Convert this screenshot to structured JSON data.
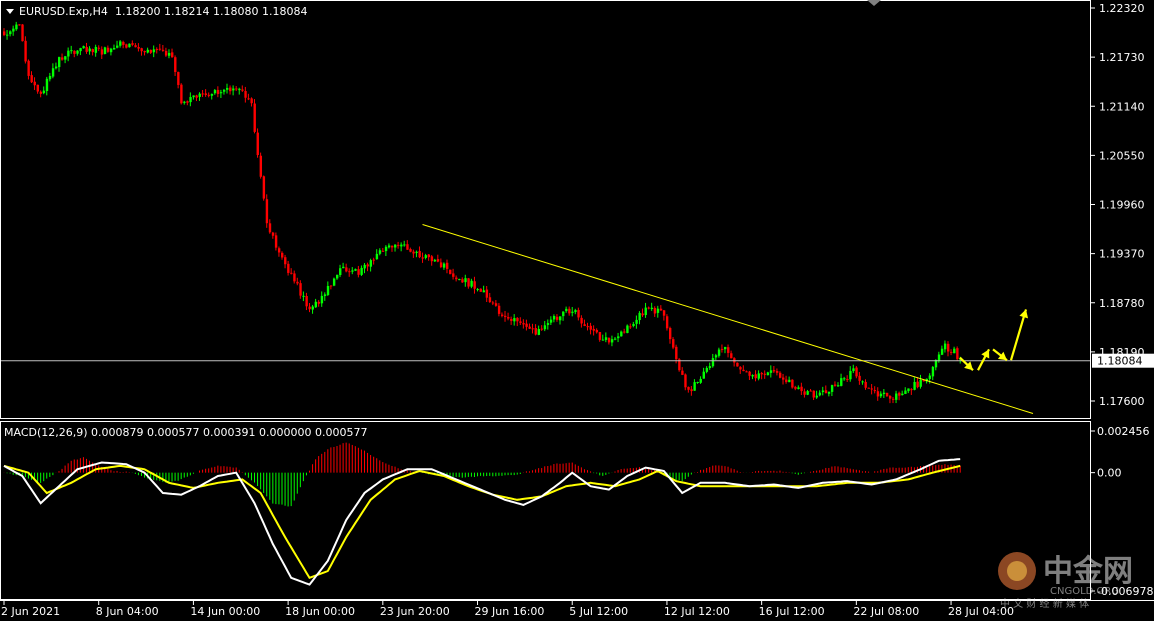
{
  "header": {
    "symbol": "EURUSD.Exp,H4",
    "ohlc": "1.18200 1.18214 1.18080 1.18084"
  },
  "macd_header": "MACD(12,26,9) 0.000879 0.000577 0.000391 0.000000 0.000577",
  "watermark": {
    "main": "中金网",
    "site": "CNGOLD.ORG",
    "sub": "中 文 财 经 新 媒 体"
  },
  "colors": {
    "background": "#000000",
    "bull": "#00ff00",
    "bear": "#ff0000",
    "trendline": "#ffff00",
    "arrow": "#ffff00",
    "macd_line": "#ffffff",
    "signal_line": "#ffff00",
    "hist_pos": "#ff0000",
    "hist_neg": "#00ff00",
    "axis": "#ffffff",
    "price_line": "#c0c0c0"
  },
  "chart_data": [
    {
      "type": "candlestick",
      "title": "EURUSD.Exp,H4",
      "current_price": 1.18084,
      "current_price_label": "1.18084",
      "y_ticks": [
        "1.22320",
        "1.21730",
        "1.21140",
        "1.20550",
        "1.19960",
        "1.19370",
        "1.18780",
        "1.18190",
        "1.17600"
      ],
      "ylim": [
        1.1745,
        1.2243
      ],
      "x_ticks": [
        "2 Jun 2021",
        "8 Jun 04:00",
        "14 Jun 00:00",
        "18 Jun 00:00",
        "23 Jun 20:00",
        "29 Jun 16:00",
        "5 Jul 12:00",
        "12 Jul 12:00",
        "16 Jul 12:00",
        "22 Jul 08:00",
        "28 Jul 04:00"
      ],
      "x_tick_bar_index": [
        0,
        31,
        62,
        93,
        124,
        155,
        186,
        217,
        248,
        279,
        310
      ],
      "close_path": [
        [
          0,
          1.22
        ],
        [
          5,
          1.221
        ],
        [
          8,
          1.215
        ],
        [
          12,
          1.213
        ],
        [
          18,
          1.2172
        ],
        [
          25,
          1.2185
        ],
        [
          32,
          1.218
        ],
        [
          38,
          1.219
        ],
        [
          44,
          1.2185
        ],
        [
          50,
          1.218
        ],
        [
          55,
          1.2175
        ],
        [
          58,
          1.212
        ],
        [
          62,
          1.2125
        ],
        [
          68,
          1.213
        ],
        [
          73,
          1.2135
        ],
        [
          78,
          1.2132
        ],
        [
          81,
          1.2115
        ],
        [
          84,
          1.203
        ],
        [
          86,
          1.1975
        ],
        [
          90,
          1.1935
        ],
        [
          95,
          1.1905
        ],
        [
          100,
          1.187
        ],
        [
          104,
          1.1885
        ],
        [
          110,
          1.192
        ],
        [
          116,
          1.1915
        ],
        [
          122,
          1.1935
        ],
        [
          128,
          1.195
        ],
        [
          135,
          1.1935
        ],
        [
          143,
          1.1925
        ],
        [
          150,
          1.1905
        ],
        [
          156,
          1.1895
        ],
        [
          162,
          1.1865
        ],
        [
          168,
          1.1855
        ],
        [
          174,
          1.184
        ],
        [
          180,
          1.186
        ],
        [
          186,
          1.187
        ],
        [
          192,
          1.1845
        ],
        [
          198,
          1.183
        ],
        [
          204,
          1.185
        ],
        [
          210,
          1.187
        ],
        [
          216,
          1.1865
        ],
        [
          220,
          1.181
        ],
        [
          224,
          1.177
        ],
        [
          228,
          1.179
        ],
        [
          232,
          1.181
        ],
        [
          236,
          1.1825
        ],
        [
          240,
          1.18
        ],
        [
          246,
          1.179
        ],
        [
          252,
          1.1795
        ],
        [
          256,
          1.1785
        ],
        [
          260,
          1.1775
        ],
        [
          266,
          1.1765
        ],
        [
          272,
          1.178
        ],
        [
          278,
          1.1795
        ],
        [
          284,
          1.177
        ],
        [
          290,
          1.1765
        ],
        [
          296,
          1.1775
        ],
        [
          302,
          1.1785
        ],
        [
          305,
          1.181
        ],
        [
          308,
          1.1825
        ],
        [
          311,
          1.182
        ],
        [
          313,
          1.1808
        ]
      ],
      "trendline": {
        "start": [
          "23 Jun",
          1.1972
        ],
        "end": [
          "28 Jul",
          1.1745
        ]
      },
      "forecast_arrows": [
        [
          1.1812,
          1.1797
        ],
        [
          1.1797,
          1.1822
        ],
        [
          1.1822,
          1.1809
        ],
        [
          1.1809,
          1.187
        ]
      ]
    },
    {
      "type": "line",
      "title": "MACD(12,26,9)",
      "y_ticks": [
        "0.002456",
        "0.00",
        "-0.006978"
      ],
      "ylim": [
        -0.006978,
        0.002456
      ],
      "series": [
        {
          "name": "MACD",
          "values": [
            [
              0,
              0.0004
            ],
            [
              6,
              -0.0002
            ],
            [
              12,
              -0.0018
            ],
            [
              18,
              -0.0008
            ],
            [
              24,
              0.0002
            ],
            [
              32,
              0.0006
            ],
            [
              40,
              0.0005
            ],
            [
              46,
              0.0
            ],
            [
              52,
              -0.0012
            ],
            [
              58,
              -0.0013
            ],
            [
              64,
              -0.0008
            ],
            [
              70,
              -0.0002
            ],
            [
              76,
              0.0
            ],
            [
              82,
              -0.0018
            ],
            [
              88,
              -0.0042
            ],
            [
              94,
              -0.0062
            ],
            [
              100,
              -0.0066
            ],
            [
              106,
              -0.0052
            ],
            [
              112,
              -0.0028
            ],
            [
              118,
              -0.0012
            ],
            [
              124,
              -0.0004
            ],
            [
              132,
              0.0002
            ],
            [
              140,
              0.0002
            ],
            [
              148,
              -0.0004
            ],
            [
              156,
              -0.001
            ],
            [
              164,
              -0.0016
            ],
            [
              170,
              -0.0019
            ],
            [
              176,
              -0.0014
            ],
            [
              182,
              -0.0006
            ],
            [
              186,
              0.0
            ],
            [
              192,
              -0.0008
            ],
            [
              198,
              -0.001
            ],
            [
              204,
              -0.0002
            ],
            [
              210,
              0.0003
            ],
            [
              216,
              0.0001
            ],
            [
              222,
              -0.0012
            ],
            [
              228,
              -0.0006
            ],
            [
              236,
              -0.0006
            ],
            [
              244,
              -0.0008
            ],
            [
              252,
              -0.0007
            ],
            [
              260,
              -0.0009
            ],
            [
              268,
              -0.0006
            ],
            [
              276,
              -0.0005
            ],
            [
              284,
              -0.0007
            ],
            [
              292,
              -0.0004
            ],
            [
              300,
              0.0002
            ],
            [
              306,
              0.0007
            ],
            [
              313,
              0.0008
            ]
          ]
        },
        {
          "name": "Signal",
          "values": [
            [
              0,
              0.0004
            ],
            [
              8,
              0.0
            ],
            [
              14,
              -0.0012
            ],
            [
              22,
              -0.0006
            ],
            [
              30,
              0.0002
            ],
            [
              38,
              0.0004
            ],
            [
              46,
              0.0002
            ],
            [
              54,
              -0.0006
            ],
            [
              62,
              -0.0009
            ],
            [
              70,
              -0.0006
            ],
            [
              78,
              -0.0004
            ],
            [
              84,
              -0.0012
            ],
            [
              92,
              -0.0038
            ],
            [
              100,
              -0.0062
            ],
            [
              106,
              -0.0058
            ],
            [
              112,
              -0.0038
            ],
            [
              120,
              -0.0016
            ],
            [
              128,
              -0.0004
            ],
            [
              136,
              0.0001
            ],
            [
              144,
              -0.0002
            ],
            [
              152,
              -0.0008
            ],
            [
              160,
              -0.0013
            ],
            [
              168,
              -0.0016
            ],
            [
              176,
              -0.0014
            ],
            [
              184,
              -0.0008
            ],
            [
              192,
              -0.0006
            ],
            [
              200,
              -0.0008
            ],
            [
              208,
              -0.0004
            ],
            [
              214,
              0.0001
            ],
            [
              220,
              -0.0005
            ],
            [
              228,
              -0.0008
            ],
            [
              236,
              -0.0008
            ],
            [
              246,
              -0.0008
            ],
            [
              256,
              -0.0008
            ],
            [
              266,
              -0.0008
            ],
            [
              276,
              -0.0006
            ],
            [
              286,
              -0.0006
            ],
            [
              296,
              -0.0004
            ],
            [
              304,
              0.0
            ],
            [
              313,
              0.0004
            ]
          ]
        },
        {
          "name": "Histogram",
          "values": [
            [
              0,
              0.0
            ],
            [
              6,
              -0.0002
            ],
            [
              12,
              -0.0006
            ],
            [
              18,
              0.0001
            ],
            [
              22,
              0.0007
            ],
            [
              26,
              0.0009
            ],
            [
              30,
              0.0005
            ],
            [
              36,
              0.0001
            ],
            [
              42,
              0.0
            ],
            [
              48,
              -0.0004
            ],
            [
              54,
              -0.0006
            ],
            [
              58,
              -0.0004
            ],
            [
              64,
              0.0001
            ],
            [
              70,
              0.0004
            ],
            [
              76,
              0.0003
            ],
            [
              82,
              -0.0006
            ],
            [
              88,
              -0.0018
            ],
            [
              94,
              -0.002
            ],
            [
              98,
              -0.0005
            ],
            [
              102,
              0.0008
            ],
            [
              106,
              0.0014
            ],
            [
              112,
              0.0018
            ],
            [
              118,
              0.0013
            ],
            [
              124,
              0.0006
            ],
            [
              130,
              0.0002
            ],
            [
              136,
              0.0
            ],
            [
              144,
              -0.0002
            ],
            [
              150,
              -0.0003
            ],
            [
              156,
              -0.0002
            ],
            [
              162,
              -0.0002
            ],
            [
              168,
              -0.0001
            ],
            [
              174,
              0.0002
            ],
            [
              180,
              0.0005
            ],
            [
              186,
              0.0006
            ],
            [
              190,
              0.0002
            ],
            [
              196,
              -0.0002
            ],
            [
              202,
              0.0002
            ],
            [
              208,
              0.0003
            ],
            [
              214,
              0.0001
            ],
            [
              218,
              -0.0004
            ],
            [
              222,
              -0.0005
            ],
            [
              226,
              0.0
            ],
            [
              232,
              0.0004
            ],
            [
              236,
              0.0004
            ],
            [
              242,
              0.0
            ],
            [
              248,
              0.0001
            ],
            [
              254,
              0.0001
            ],
            [
              260,
              -0.0001
            ],
            [
              266,
              0.0001
            ],
            [
              272,
              0.0004
            ],
            [
              278,
              0.0002
            ],
            [
              284,
              0.0
            ],
            [
              290,
              0.0003
            ],
            [
              296,
              0.0003
            ],
            [
              302,
              0.0004
            ],
            [
              308,
              0.0005
            ],
            [
              313,
              0.0004
            ]
          ]
        }
      ]
    }
  ]
}
